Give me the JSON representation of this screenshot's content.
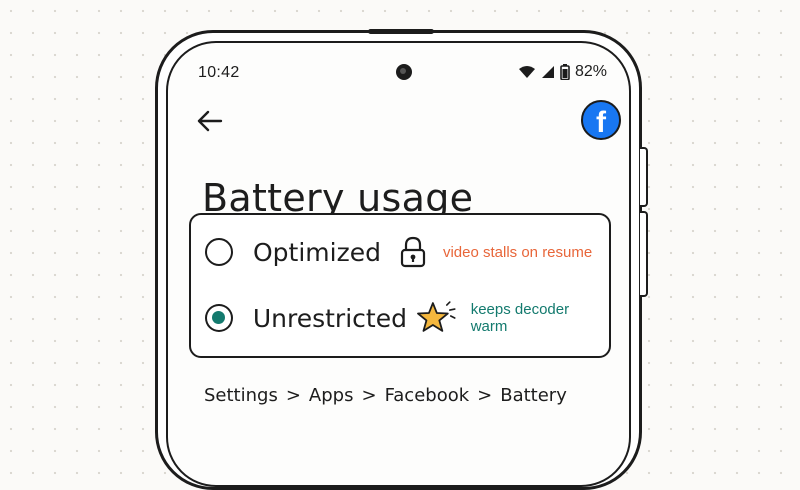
{
  "status_bar": {
    "time": "10:42",
    "battery": "82%",
    "icons": [
      "wifi-icon",
      "signal-icon",
      "battery-icon"
    ]
  },
  "app_bar": {
    "back_icon": "back-arrow-icon",
    "app_icon": "facebook-icon",
    "app_icon_glyph": "f"
  },
  "page": {
    "title": "Battery usage"
  },
  "options": [
    {
      "label": "Optimized",
      "selected": false,
      "icon": "lock-icon",
      "note": "video stalls on resume",
      "note_color": "#e8663a"
    },
    {
      "label": "Unrestricted",
      "selected": true,
      "icon": "star-icon",
      "note": "keeps decoder warm",
      "note_color": "#137a6e"
    }
  ],
  "breadcrumb": {
    "items": [
      "Settings",
      "Apps",
      "Facebook",
      "Battery"
    ],
    "separator": ">"
  },
  "colors": {
    "accent": "#137a6e",
    "warning": "#e8663a",
    "facebook_blue": "#1877f2",
    "star": "#f4b73e"
  }
}
